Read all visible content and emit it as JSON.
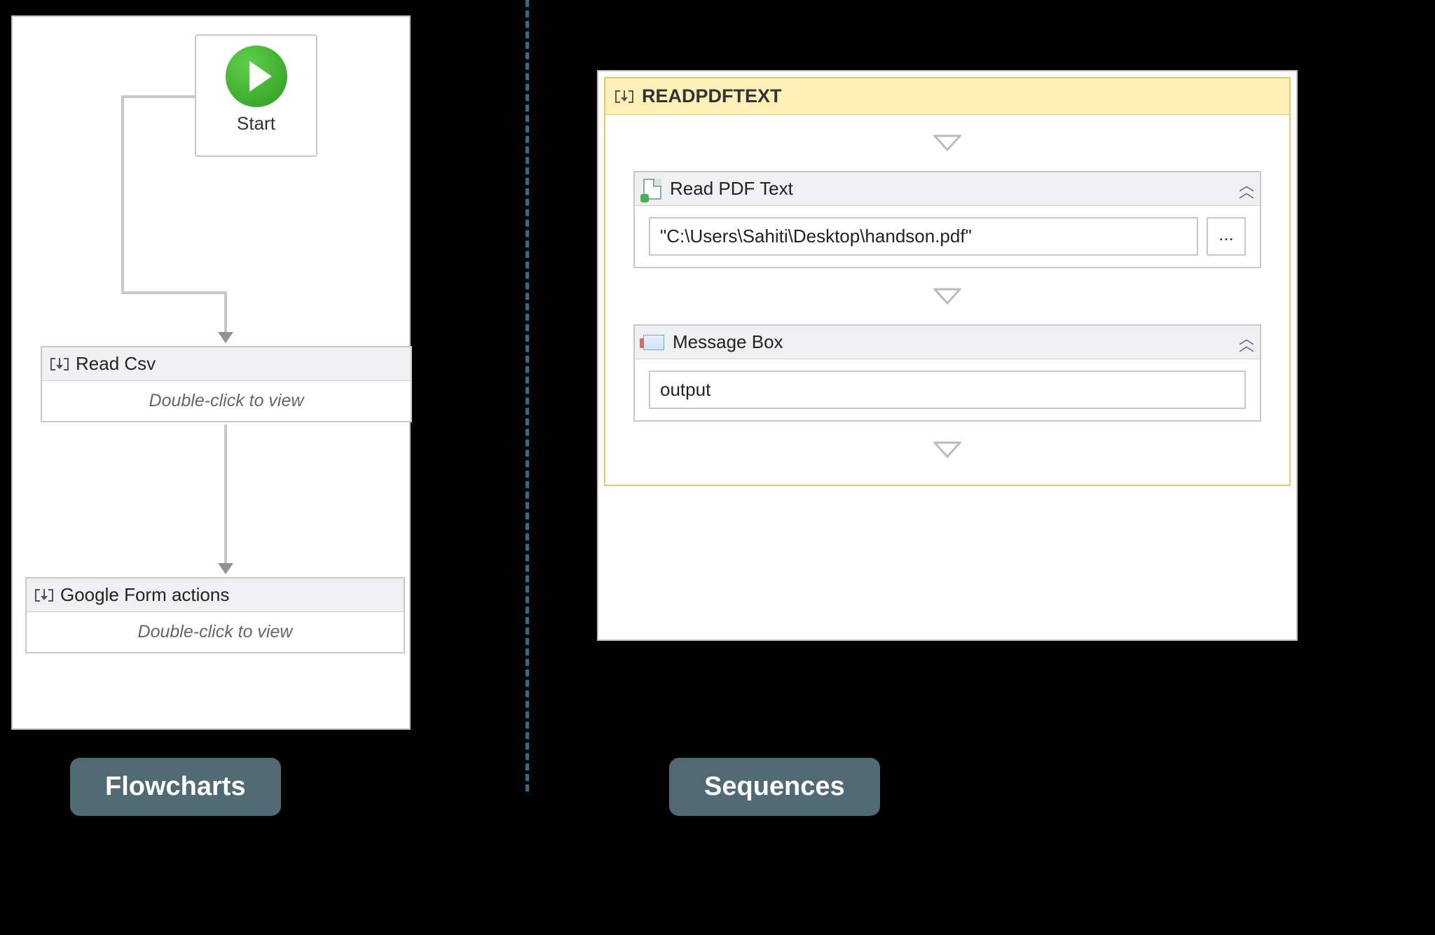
{
  "labels": {
    "flowcharts": "Flowcharts",
    "sequences": "Sequences"
  },
  "flowchart": {
    "start_label": "Start",
    "nodes": [
      {
        "title": "Read Csv",
        "hint": "Double-click to view"
      },
      {
        "title": "Google Form actions",
        "hint": "Double-click to view"
      }
    ]
  },
  "sequence": {
    "title": "READPDFTEXT",
    "activities": {
      "read_pdf": {
        "title": "Read PDF Text",
        "file_value": "\"C:\\Users\\Sahiti\\Desktop\\handson.pdf\"",
        "browse_label": "..."
      },
      "message_box": {
        "title": "Message Box",
        "value": "output"
      }
    }
  }
}
